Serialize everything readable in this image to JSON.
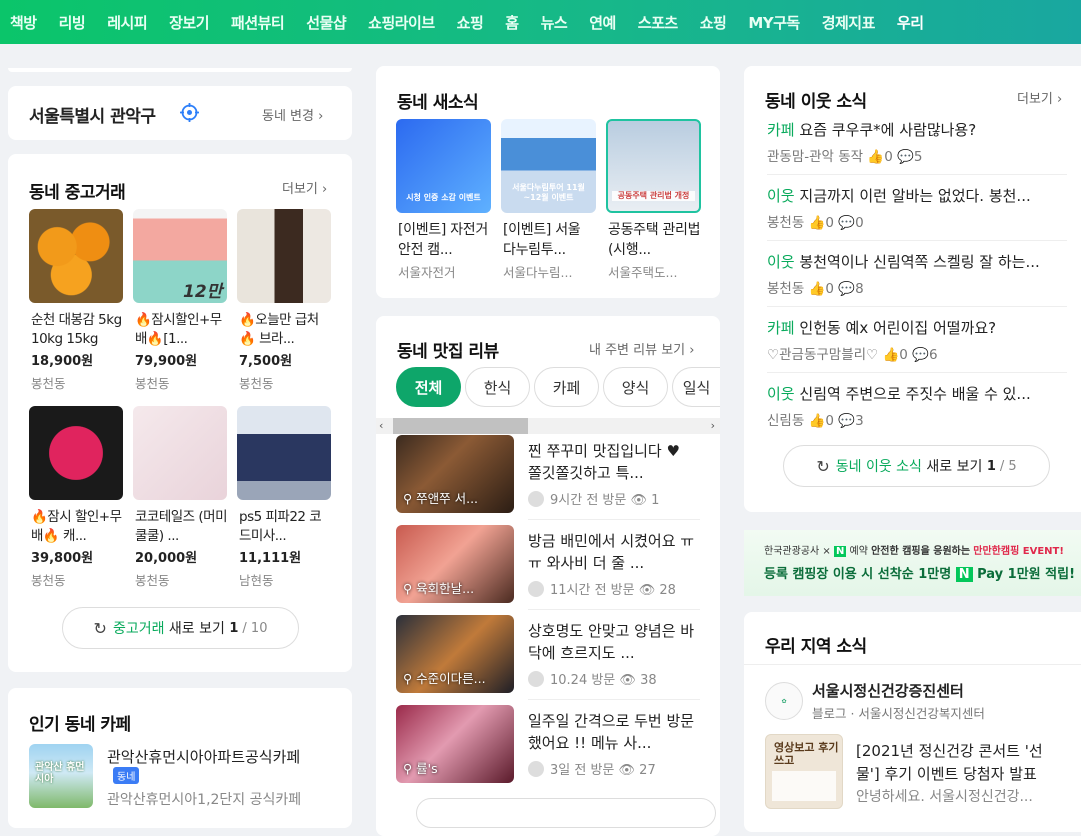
{
  "nav": {
    "tabs": [
      "책방",
      "리빙",
      "레시피",
      "장보기",
      "패션뷰티",
      "선물샵",
      "쇼핑라이브",
      "쇼핑",
      "홈",
      "뉴스",
      "연예",
      "스포츠",
      "쇼핑",
      "MY구독",
      "경제지표",
      "우리"
    ]
  },
  "location": {
    "name": "서울특별시 관악구",
    "change_label": "동네 변경"
  },
  "market": {
    "title": "동네 중고거래",
    "more": "더보기",
    "items": [
      {
        "title": "순천 대봉감 5kg 10kg 15kg",
        "price": "18,900원",
        "area": "봉천동"
      },
      {
        "title": "🔥잠시할인+무배🔥[1...",
        "price": "79,900원",
        "area": "봉천동"
      },
      {
        "title": "🔥오늘만 급처🔥 브라...",
        "price": "7,500원",
        "area": "봉천동"
      },
      {
        "title": "🔥잠시 할인+무배🔥 캐...",
        "price": "39,800원",
        "area": "봉천동"
      },
      {
        "title": "코코테일즈 (머미쿨쿨) ...",
        "price": "20,000원",
        "area": "봉천동"
      },
      {
        "title": "ps5 피파22 코드미사...",
        "price": "11,111원",
        "area": "남현동"
      }
    ],
    "img_text_12": "12만",
    "reload_label": "중고거래",
    "reload_suffix": "새로 보기",
    "reload_count": "1",
    "reload_total": "/ 10"
  },
  "cafe": {
    "title": "인기 동네 카페",
    "name": "관악산휴먼시아아파트공식카페",
    "badge": "동네",
    "desc": "관악산휴먼시아1,2단지 공식카페",
    "thumb_text": "관악산 휴먼시아"
  },
  "news": {
    "title": "동네 새소식",
    "items": [
      {
        "title": "[이벤트] 자전거 안전 캠...",
        "source": "서울자전거",
        "thumb_text": "시청 인증 소감 이벤트"
      },
      {
        "title": "[이벤트] 서울 다누림투...",
        "source": "서울다누림...",
        "thumb_text": "서울다누림투어 11월~12월 이벤트"
      },
      {
        "title": "공동주택 관리법(시행...",
        "source": "서울주택도...",
        "thumb_text": "공동주택 관리법 개정"
      }
    ]
  },
  "reviews": {
    "title": "동네 맛집 리뷰",
    "more": "내 주변 리뷰 보기",
    "chips": [
      "전체",
      "한식",
      "카페",
      "양식",
      "일식"
    ],
    "items": [
      {
        "text": "찐 쭈꾸미 맛집입니다 ♥ 쫄깃쫄깃하고 특...",
        "place": "쭈앤쭈 서...",
        "time": "9시간 전 방문",
        "views": "1"
      },
      {
        "text": "방금 배민에서 시켰어요 ㅠㅠ 와사비 더 줄 ...",
        "place": "육회한날...",
        "time": "11시간 전 방문",
        "views": "28"
      },
      {
        "text": "상호명도 안맞고 양념은 바닥에 흐르지도 ...",
        "place": "수준이다른...",
        "time": "10.24 방문",
        "views": "38"
      },
      {
        "text": "일주일 간격으로 두번 방문했어요 !! 메뉴 사...",
        "place": "률's",
        "time": "3일 전 방문",
        "views": "27"
      }
    ]
  },
  "neighbors": {
    "title": "동네 이웃 소식",
    "more": "더보기",
    "items": [
      {
        "tag": "카페",
        "text": "요즘 쿠우쿠*에 사람많나용?",
        "author": "관동맘-관악 동작",
        "likes": "0",
        "comments": "5"
      },
      {
        "tag": "이웃",
        "text": "지금까지 이런 알바는 없었다. 봉천...",
        "author": "봉천동",
        "likes": "0",
        "comments": "0"
      },
      {
        "tag": "이웃",
        "text": "봉천역이나 신림역쪽 스켈링 잘 하는...",
        "author": "봉천동",
        "likes": "0",
        "comments": "8"
      },
      {
        "tag": "카페",
        "text": "인헌동 예x 어린이집 어떨까요?",
        "author": "♡관금동구맘블리♡",
        "likes": "0",
        "comments": "6"
      },
      {
        "tag": "이웃",
        "text": "신림역 주변으로 주짓수 배울 수 있...",
        "author": "신림동",
        "likes": "0",
        "comments": "3"
      }
    ],
    "reload_label": "동네 이웃 소식",
    "reload_suffix": "새로 보기",
    "reload_count": "1",
    "reload_total": "/ 5"
  },
  "banner": {
    "line1a": "한국관광공사 ×",
    "line1b": "예약",
    "line1c": "안전한 캠핑을 응원하는",
    "line1d": "만만한캠핑 EVENT!",
    "line2a": "등록 캠핑장 이용 시 선착순 1만명",
    "line2b": "Pay 1만원 적립!"
  },
  "region": {
    "title": "우리 지역 소식",
    "org": "서울시정신건강증진센터",
    "org_sub": "블로그 · 서울시정신건강복지센터",
    "post": "[2021년 정신건강 콘서트 '선물'] 후기 이벤트 당첨자 발표",
    "post_sub": "안녕하세요. 서울시정신건강...",
    "thumb_text": "영상보고 후기쓰고"
  }
}
